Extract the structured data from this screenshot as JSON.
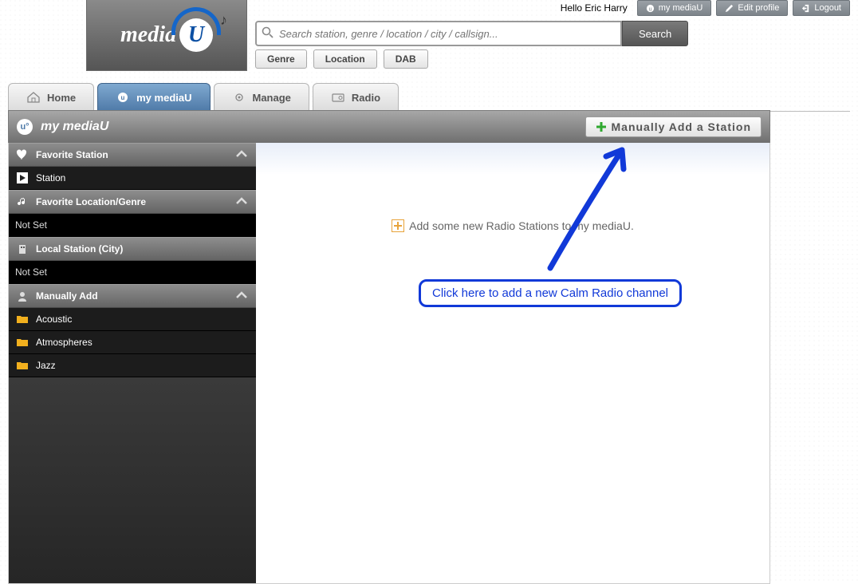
{
  "user": {
    "greeting": "Hello Eric Harry"
  },
  "topLinks": {
    "myMediaU": "my mediaU",
    "editProfile": "Edit profile",
    "logout": "Logout"
  },
  "search": {
    "placeholder": "Search station, genre / location / city / callsign...",
    "button": "Search"
  },
  "filters": {
    "genre": "Genre",
    "location": "Location",
    "dab": "DAB"
  },
  "logo": {
    "brand": "media",
    "letter": "U"
  },
  "tabs": {
    "home": "Home",
    "myMediaU": "my mediaU",
    "manage": "Manage",
    "radio": "Radio"
  },
  "header": {
    "title": "my mediaU",
    "addButton": "Manually Add a Station"
  },
  "sidebar": {
    "favStation": "Favorite Station",
    "station": "Station",
    "favLocGenre": "Favorite Location/Genre",
    "notSet": "Not Set",
    "localStation": "Local Station (City)",
    "manuallyAdd": "Manually Add",
    "items": [
      "Acoustic",
      "Atmospheres",
      "Jazz"
    ]
  },
  "main": {
    "emptyMsg": "Add some new Radio Stations to my mediaU."
  },
  "annotation": {
    "callout": "Click here to add a new Calm Radio channel"
  }
}
